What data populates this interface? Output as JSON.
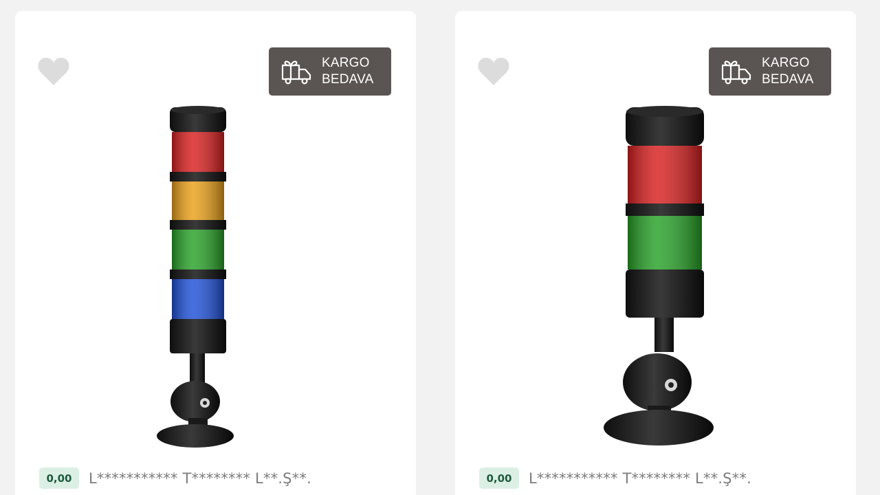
{
  "products": [
    {
      "badge": {
        "line1": "KARGO",
        "line2": "BEDAVA",
        "icon": "delivery-truck-gift-icon"
      },
      "favorite_icon": "heart-icon",
      "image": {
        "tower_lights": [
          "#e02020",
          "#f0a010",
          "#2ea82e",
          "#2050e0"
        ]
      },
      "rating": "0,00",
      "name": "L*********** T******** L**.Ş**."
    },
    {
      "badge": {
        "line1": "KARGO",
        "line2": "BEDAVA",
        "icon": "delivery-truck-gift-icon"
      },
      "favorite_icon": "heart-icon",
      "image": {
        "tower_lights": [
          "#e02020",
          "#2ea82e"
        ]
      },
      "rating": "0,00",
      "name": "L*********** T******** L**.Ş**."
    }
  ],
  "colors": {
    "page_bg": "#f2f2f2",
    "card_bg": "#ffffff",
    "badge_bg": "#5a5452",
    "rating_bg": "#dcefe5",
    "rating_text": "#1f5c3d"
  }
}
